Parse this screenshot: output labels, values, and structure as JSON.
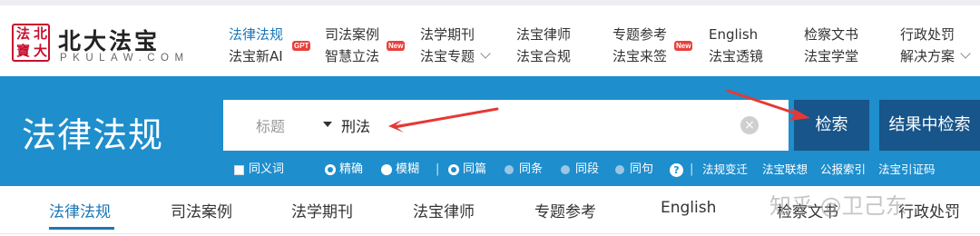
{
  "logo": {
    "seal_chars": [
      "法",
      "北",
      "寶",
      "大"
    ],
    "name_cn": "北大法宝",
    "name_en": "PKULAW.COM"
  },
  "nav": {
    "columns": [
      {
        "top": "法律法规",
        "bottom": "法宝新AI",
        "bottom_badge": "GPT"
      },
      {
        "top": "司法案例",
        "bottom": "智慧立法",
        "bottom_badge": "New"
      },
      {
        "top": "法学期刊",
        "bottom": "法宝专题"
      },
      {
        "top": "法宝律师",
        "bottom": "法宝合规"
      },
      {
        "top": "专题参考",
        "bottom": "法宝来签",
        "bottom_badge": "New"
      },
      {
        "top": "English",
        "bottom": "法宝透镜"
      },
      {
        "top": "检察文书",
        "bottom": "法宝学堂"
      },
      {
        "top": "行政处罚",
        "bottom": "解决方案"
      }
    ]
  },
  "search": {
    "page_title": "法律法规",
    "field": "标题",
    "query": "刑法",
    "clear_symbol": "×",
    "search_button": "检索",
    "search_within_button": "结果中检索"
  },
  "options": {
    "synonym": "同义词",
    "exact": "精确",
    "fuzzy": "模糊",
    "separator": "|",
    "same_article": "同篇",
    "same_clause": "同条",
    "same_paragraph": "同段",
    "same_sentence": "同句",
    "help": "?",
    "links": [
      "法规变迁",
      "法宝联想",
      "公报索引",
      "法宝引证码"
    ]
  },
  "tabs": {
    "items": [
      "法律法规",
      "司法案例",
      "法学期刊",
      "法宝律师",
      "专题参考",
      "English",
      "检察文书",
      "行政处罚"
    ],
    "active_index": 0
  },
  "watermark": "知乎 @卫己东",
  "colors": {
    "band": "#1e8ecd",
    "button": "#17558a",
    "active_text": "#1a77b8",
    "badge": "#e8413b",
    "annotation_arrow": "#e53935"
  }
}
